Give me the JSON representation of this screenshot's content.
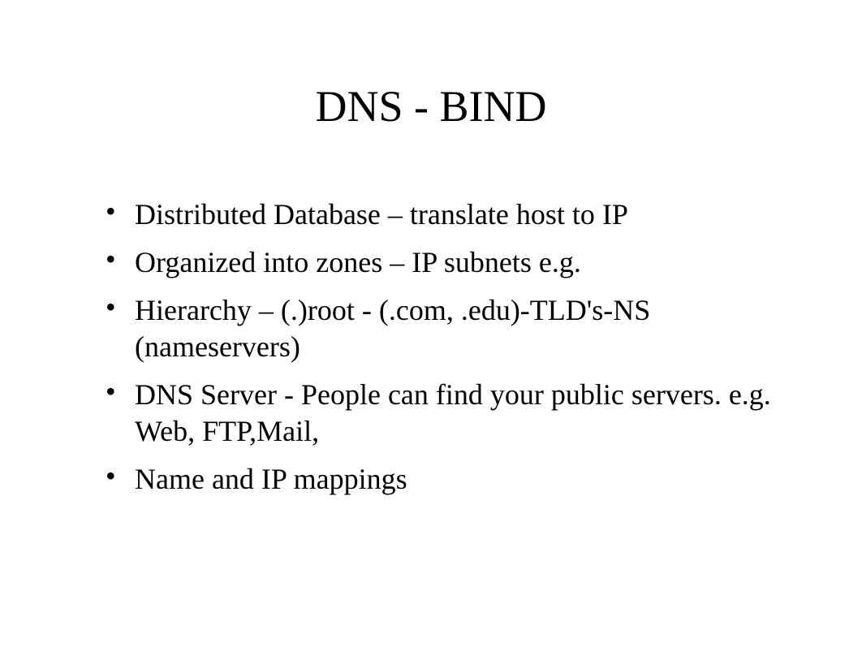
{
  "slide": {
    "title": "DNS - BIND",
    "bullets": [
      "Distributed Database – translate host to IP",
      "Organized into zones – IP subnets e.g.",
      "Hierarchy – (.)root - (.com, .edu)-TLD's-NS (nameservers)",
      "DNS Server -  People can find your public servers. e.g. Web, FTP,Mail,",
      "Name and IP mappings"
    ]
  }
}
